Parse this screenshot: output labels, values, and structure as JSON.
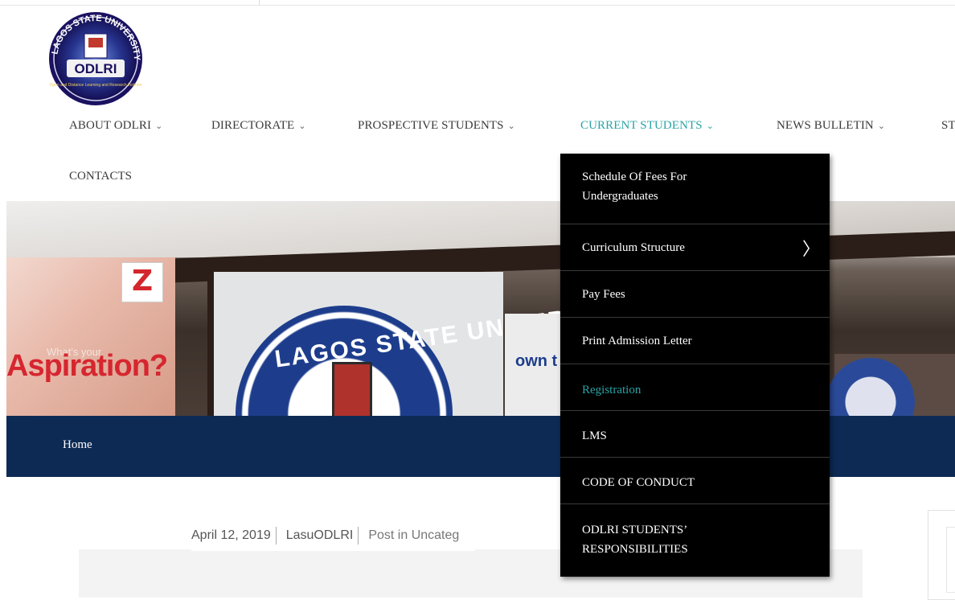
{
  "logo": {
    "top_text": "LAGOS STATE UNIVERSITY",
    "badge_text": "ODLRI",
    "bottom_text": "Open and Distance Learning and Research Institute"
  },
  "nav": {
    "items": [
      {
        "label": "ABOUT ODLRI"
      },
      {
        "label": "DIRECTORATE"
      },
      {
        "label": "PROSPECTIVE STUDENTS"
      },
      {
        "label": "CURRENT STUDENTS"
      },
      {
        "label": "NEWS BULLETIN"
      },
      {
        "label": "ST"
      }
    ],
    "contacts": "CONTACTS",
    "chevron": "⌄"
  },
  "hero": {
    "aspiration_text": "Aspiration?",
    "whats_text": "What's your",
    "seal_text": "LAGOS STATE UNIVERSITY",
    "own_text": "own t"
  },
  "breadcrumb": {
    "home": "Home"
  },
  "post_meta": {
    "date": "April 12, 2019",
    "author": "LasuODLRI",
    "category": "Post in Uncateg"
  },
  "dropdown": {
    "items": [
      {
        "line1": "Schedule Of Fees For",
        "line2": "Undergraduates"
      },
      {
        "label": "Curriculum Structure",
        "arrow": "〉"
      },
      {
        "label": "Pay Fees"
      },
      {
        "label": "Print Admission Letter"
      },
      {
        "label": "Registration"
      },
      {
        "label": "LMS"
      },
      {
        "label": "CODE OF CONDUCT"
      },
      {
        "line1": "ODLRI STUDENTS’",
        "line2": "RESPONSIBILITIES"
      }
    ]
  },
  "colors": {
    "accent": "#2aa3a6",
    "band": "#0d2a55",
    "dropdown_bg": "#000000"
  }
}
